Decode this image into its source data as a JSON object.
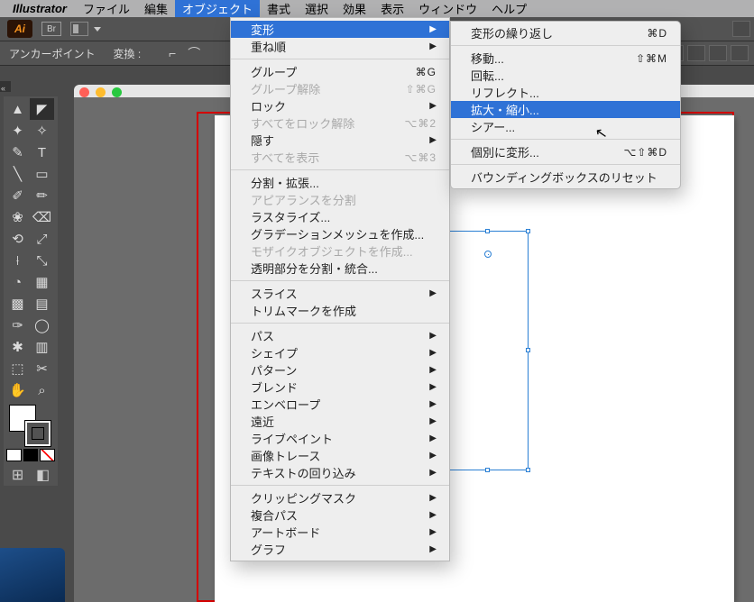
{
  "mac_menu": {
    "apple": "",
    "app": "Illustrator",
    "items": [
      "ファイル",
      "編集",
      "オブジェクト",
      "書式",
      "選択",
      "効果",
      "表示",
      "ウィンドウ",
      "ヘルプ"
    ],
    "selected_index": 2
  },
  "ai_logo": "Ai",
  "br_label": "Br",
  "control_bar": {
    "anchor_label": "アンカーポイント",
    "convert_label": "変換 :"
  },
  "object_menu": {
    "transform": {
      "label": "変形"
    },
    "arrange": {
      "label": "重ね順"
    },
    "group": {
      "label": "グループ",
      "sc": "⌘G"
    },
    "ungroup": {
      "label": "グループ解除",
      "sc": "⇧⌘G"
    },
    "lock": {
      "label": "ロック"
    },
    "unlock_all": {
      "label": "すべてをロック解除",
      "sc": "⌥⌘2"
    },
    "hide": {
      "label": "隠す"
    },
    "show_all": {
      "label": "すべてを表示",
      "sc": "⌥⌘3"
    },
    "expand": {
      "label": "分割・拡張..."
    },
    "expand_appear": {
      "label": "アピアランスを分割"
    },
    "rasterize": {
      "label": "ラスタライズ..."
    },
    "gradient_mesh": {
      "label": "グラデーションメッシュを作成..."
    },
    "mosaic": {
      "label": "モザイクオブジェクトを作成..."
    },
    "flatten": {
      "label": "透明部分を分割・統合..."
    },
    "slice": {
      "label": "スライス"
    },
    "trim_marks": {
      "label": "トリムマークを作成"
    },
    "path": {
      "label": "パス"
    },
    "shape": {
      "label": "シェイプ"
    },
    "pattern": {
      "label": "パターン"
    },
    "blend": {
      "label": "ブレンド"
    },
    "envelope": {
      "label": "エンベロープ"
    },
    "perspective": {
      "label": "遠近"
    },
    "live_paint": {
      "label": "ライブペイント"
    },
    "image_trace": {
      "label": "画像トレース"
    },
    "text_wrap": {
      "label": "テキストの回り込み"
    },
    "clip_mask": {
      "label": "クリッピングマスク"
    },
    "compound": {
      "label": "複合パス"
    },
    "artboards": {
      "label": "アートボード"
    },
    "graph": {
      "label": "グラフ"
    }
  },
  "transform_menu": {
    "again": {
      "label": "変形の繰り返し",
      "sc": "⌘D"
    },
    "move": {
      "label": "移動...",
      "sc": "⇧⌘M"
    },
    "rotate": {
      "label": "回転..."
    },
    "reflect": {
      "label": "リフレクト..."
    },
    "scale": {
      "label": "拡大・縮小..."
    },
    "shear": {
      "label": "シアー..."
    },
    "each": {
      "label": "個別に変形...",
      "sc": "⌥⇧⌘D"
    },
    "reset_bb": {
      "label": "バウンディングボックスのリセット"
    }
  },
  "tool_glyphs": [
    "▲",
    "◆",
    "✦",
    "✧",
    "✎",
    "T",
    "╱",
    "▭",
    "✂",
    "◔",
    "✑",
    "⌫",
    "▱",
    "▦",
    "◉",
    "⟲",
    "⤢",
    "⬚",
    "▤",
    "▦",
    "⌖",
    "⊞",
    "◧",
    "║",
    "⚲",
    "✋",
    "⌕"
  ],
  "cursor": "↖"
}
